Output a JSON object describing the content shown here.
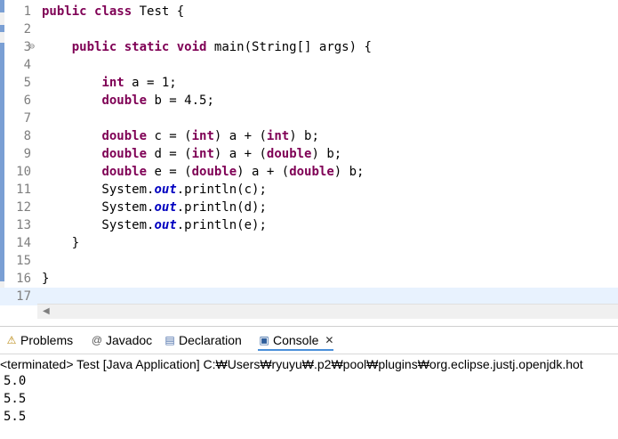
{
  "editor": {
    "lines": [
      {
        "num": "1",
        "fold": "",
        "html": [
          [
            "kw",
            "public"
          ],
          [
            "",
            " "
          ],
          [
            "kw",
            "class"
          ],
          [
            "",
            " Test {"
          ]
        ]
      },
      {
        "num": "2",
        "fold": "",
        "html": []
      },
      {
        "num": "3",
        "fold": "⊖",
        "html": [
          [
            "",
            "    "
          ],
          [
            "kw",
            "public"
          ],
          [
            "",
            " "
          ],
          [
            "kw",
            "static"
          ],
          [
            "",
            " "
          ],
          [
            "kw",
            "void"
          ],
          [
            "",
            " main(String[] args) {"
          ]
        ]
      },
      {
        "num": "4",
        "fold": "",
        "html": []
      },
      {
        "num": "5",
        "fold": "",
        "html": [
          [
            "",
            "        "
          ],
          [
            "kw",
            "int"
          ],
          [
            "",
            " a = 1;"
          ]
        ]
      },
      {
        "num": "6",
        "fold": "",
        "html": [
          [
            "",
            "        "
          ],
          [
            "kw",
            "double"
          ],
          [
            "",
            " b = 4.5;"
          ]
        ]
      },
      {
        "num": "7",
        "fold": "",
        "html": []
      },
      {
        "num": "8",
        "fold": "",
        "html": [
          [
            "",
            "        "
          ],
          [
            "kw",
            "double"
          ],
          [
            "",
            " c = ("
          ],
          [
            "kw",
            "int"
          ],
          [
            "",
            ") a + ("
          ],
          [
            "kw",
            "int"
          ],
          [
            "",
            ") b;"
          ]
        ]
      },
      {
        "num": "9",
        "fold": "",
        "html": [
          [
            "",
            "        "
          ],
          [
            "kw",
            "double"
          ],
          [
            "",
            " d = ("
          ],
          [
            "kw",
            "int"
          ],
          [
            "",
            ") a + ("
          ],
          [
            "kw",
            "double"
          ],
          [
            "",
            ") b;"
          ]
        ]
      },
      {
        "num": "10",
        "fold": "",
        "html": [
          [
            "",
            "        "
          ],
          [
            "kw",
            "double"
          ],
          [
            "",
            " e = ("
          ],
          [
            "kw",
            "double"
          ],
          [
            "",
            ") a + ("
          ],
          [
            "kw",
            "double"
          ],
          [
            "",
            ") b;"
          ]
        ]
      },
      {
        "num": "11",
        "fold": "",
        "html": [
          [
            "",
            "        System."
          ],
          [
            "st",
            "out"
          ],
          [
            "",
            ".println(c);"
          ]
        ]
      },
      {
        "num": "12",
        "fold": "",
        "html": [
          [
            "",
            "        System."
          ],
          [
            "st",
            "out"
          ],
          [
            "",
            ".println(d);"
          ]
        ]
      },
      {
        "num": "13",
        "fold": "",
        "html": [
          [
            "",
            "        System."
          ],
          [
            "st",
            "out"
          ],
          [
            "",
            ".println(e);"
          ]
        ]
      },
      {
        "num": "14",
        "fold": "",
        "html": [
          [
            "",
            "    }"
          ]
        ]
      },
      {
        "num": "15",
        "fold": "",
        "html": []
      },
      {
        "num": "16",
        "fold": "",
        "html": [
          [
            "",
            "}"
          ]
        ]
      },
      {
        "num": "17",
        "fold": "",
        "html": []
      }
    ]
  },
  "panel": {
    "tabs": [
      {
        "label": "Problems",
        "icon": "problems-icon",
        "glyph": "⚠"
      },
      {
        "label": "Javadoc",
        "icon": "javadoc-icon",
        "glyph": "@"
      },
      {
        "label": "Declaration",
        "icon": "declaration-icon",
        "glyph": "▤"
      },
      {
        "label": "Console",
        "icon": "console-icon",
        "glyph": "▣"
      }
    ],
    "close_glyph": "✕",
    "terminated": "<terminated> Test [Java Application] C:₩Users₩ryuyu₩.p2₩pool₩plugins₩org.eclipse.justj.openjdk.hot",
    "output": [
      "5.0",
      "5.5",
      "5.5"
    ]
  },
  "colors": {
    "keyword": "#7f0055",
    "static_field": "#0000c0",
    "ruler_mark": "#7a9fd4",
    "active_tab": "#4a8fd9"
  }
}
